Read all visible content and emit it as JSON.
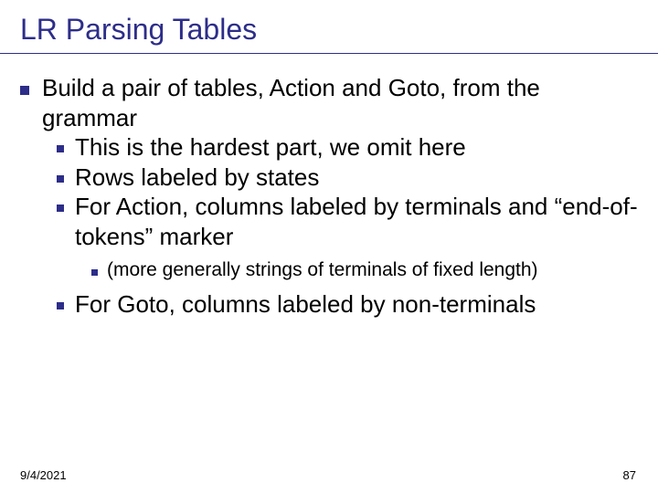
{
  "title": "LR Parsing Tables",
  "bullets": {
    "main": "Build a pair of tables, Action and Goto, from the grammar",
    "sub": [
      "This is the hardest part, we omit here",
      "Rows labeled by states",
      "For Action, columns labeled by terminals and “end-of-tokens” marker"
    ],
    "subsub": "(more generally strings of terminals of fixed length)",
    "sub_after": "For Goto, columns labeled by non-terminals"
  },
  "footer": {
    "date": "9/4/2021",
    "page": "87"
  }
}
